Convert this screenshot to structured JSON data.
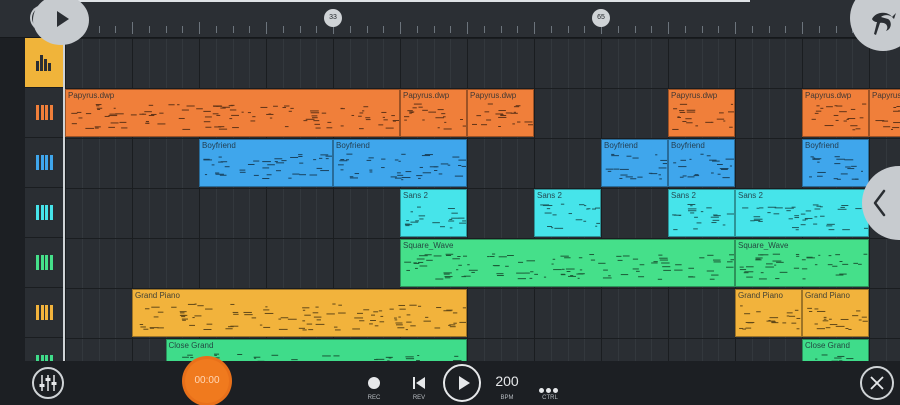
{
  "timeline": {
    "bar_markers": [
      "33",
      "65"
    ]
  },
  "side_panel": {
    "toggle_icon": "chevron-left-icon"
  },
  "tracks": [
    {
      "name_icon": "piano-keys-icon",
      "color": "#f07f3a",
      "clips": [
        {
          "label": "Papyrus.dwp",
          "start": 0,
          "end": 20
        },
        {
          "label": "Papyrus.dwp",
          "start": 20,
          "end": 24
        },
        {
          "label": "Papyrus.dwp",
          "start": 24,
          "end": 28
        },
        {
          "label": "Papyrus.dwp",
          "start": 36,
          "end": 40
        },
        {
          "label": "Papyrus.dwp",
          "start": 44,
          "end": 48
        },
        {
          "label": "Papyrus.dwp",
          "start": 48,
          "end": 50
        }
      ]
    },
    {
      "name_icon": "piano-keys-icon",
      "color": "#3fa6ec",
      "clips": [
        {
          "label": "Boyfriend",
          "start": 8,
          "end": 16
        },
        {
          "label": "Boyfriend",
          "start": 16,
          "end": 24
        },
        {
          "label": "Boyfriend",
          "start": 32,
          "end": 36
        },
        {
          "label": "Boyfriend",
          "start": 36,
          "end": 40
        },
        {
          "label": "Boyfriend",
          "start": 44,
          "end": 48
        }
      ]
    },
    {
      "name_icon": "piano-keys-icon",
      "color": "#46e4ea",
      "clips": [
        {
          "label": "Sans 2",
          "start": 20,
          "end": 24
        },
        {
          "label": "Sans 2",
          "start": 28,
          "end": 32
        },
        {
          "label": "Sans 2",
          "start": 36,
          "end": 40
        },
        {
          "label": "Sans 2",
          "start": 40,
          "end": 48
        }
      ]
    },
    {
      "name_icon": "piano-keys-icon",
      "color": "#45e08a",
      "clips": [
        {
          "label": "Square_Wave",
          "start": 20,
          "end": 40
        },
        {
          "label": "Square_Wave",
          "start": 40,
          "end": 48
        }
      ]
    },
    {
      "name_icon": "piano-keys-icon",
      "color": "#f2b33c",
      "clips": [
        {
          "label": "Grand Piano",
          "start": 4,
          "end": 24
        },
        {
          "label": "Grand Piano",
          "start": 40,
          "end": 44
        },
        {
          "label": "Grand Piano",
          "start": 44,
          "end": 48
        }
      ]
    },
    {
      "name_icon": "piano-keys-icon",
      "color": "#3fdc8a",
      "clips": [
        {
          "label": "Close Grand",
          "start": 6,
          "end": 24
        },
        {
          "label": "Close Grand",
          "start": 44,
          "end": 48
        }
      ]
    }
  ],
  "transport": {
    "time": "00:00",
    "rec_label": "REC",
    "rev_label": "REV",
    "bpm_value": "200",
    "bpm_label": "BPM",
    "ctrl_label": "CTRL"
  },
  "icons": {
    "play": "play-icon",
    "mixer": "mixer-icon",
    "brand": "fruit-logo-icon",
    "close": "close-icon"
  }
}
